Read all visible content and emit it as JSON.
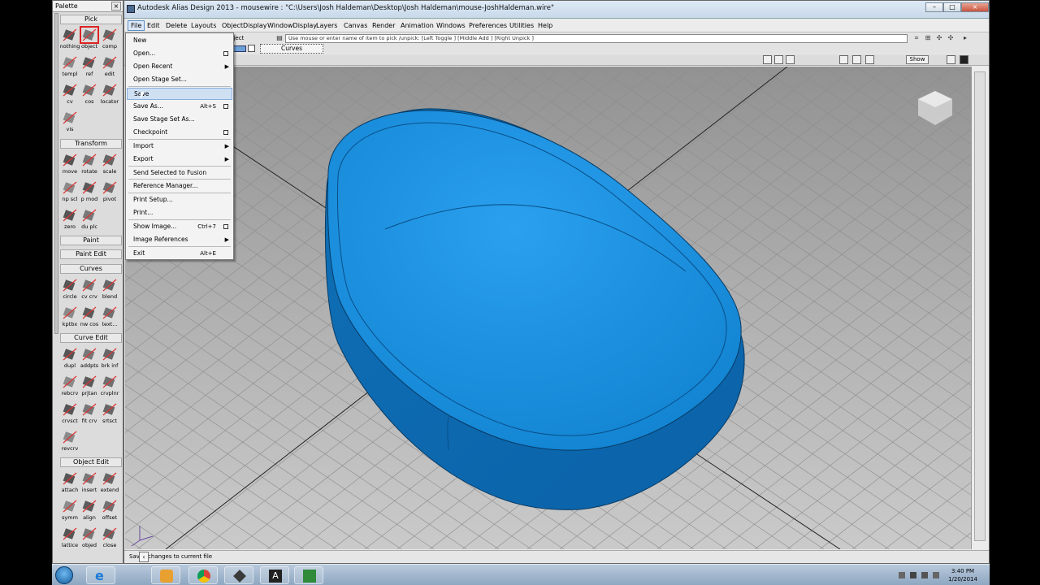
{
  "palette": {
    "title": "Palette",
    "sections": {
      "pick": "Pick",
      "transform": "Transform",
      "paint": "Paint",
      "paint_edit": "Paint Edit",
      "curves": "Curves",
      "curve_edit": "Curve Edit",
      "object_edit": "Object Edit"
    },
    "pick_tools": [
      "nothing",
      "object",
      "comp",
      "templ",
      "ref",
      "edit",
      "cv",
      "cos",
      "locator",
      "vis"
    ],
    "transform_tools": [
      "move",
      "rotate",
      "scale",
      "np scl",
      "p mod",
      "pivot",
      "zero",
      "du plc"
    ],
    "curve_tools": [
      "circle",
      "cv crv",
      "blend",
      "kptbx",
      "nw cos",
      "text..."
    ],
    "curve_edit_tools": [
      "dupl",
      "addpts",
      "brk inf",
      "rebcrv",
      "prjtan",
      "crvplnr",
      "crvsct",
      "fit crv",
      "srtsct",
      "revcrv"
    ],
    "object_edit_tools": [
      "attach",
      "insert",
      "extend",
      "symm",
      "align",
      "offset",
      "lattice",
      "objed",
      "close"
    ]
  },
  "window": {
    "title": "Autodesk Alias Design 2013 - mousewire : \"C:\\Users\\Josh Haldeman\\Desktop\\Josh Haldeman\\mouse-JoshHaldeman.wire\"",
    "menus": [
      "File",
      "Edit",
      "Delete",
      "Layouts",
      "ObjectDisplay",
      "WindowDisplay",
      "Layers",
      "Canvas",
      "Render",
      "Animation",
      "Windows",
      "Preferences",
      "Utilities",
      "Help"
    ],
    "prompt_label": "bject",
    "prompt_text": "Use mouse or enter name of item to pick /unpick: [Left Toggle ] [Middle Add ] [Right Unpick ]",
    "shelf_tab": "Curves",
    "show_button": "Show",
    "status_text": "Saves changes to current file"
  },
  "file_menu": [
    {
      "label": "New",
      "shortcut": "",
      "arrow": false,
      "box": false
    },
    {
      "label": "Open...",
      "shortcut": "",
      "arrow": false,
      "box": true
    },
    {
      "label": "Open Recent",
      "shortcut": "",
      "arrow": true,
      "box": false
    },
    {
      "label": "Open Stage Set...",
      "shortcut": "",
      "arrow": false,
      "box": false
    },
    {
      "label": "Save",
      "shortcut": "",
      "arrow": false,
      "box": false
    },
    {
      "label": "Save As...",
      "shortcut": "Alt+S",
      "arrow": false,
      "box": true
    },
    {
      "label": "Save Stage Set As...",
      "shortcut": "",
      "arrow": false,
      "box": false
    },
    {
      "label": "Checkpoint",
      "shortcut": "",
      "arrow": false,
      "box": true
    },
    {
      "label": "Import",
      "shortcut": "",
      "arrow": true,
      "box": false
    },
    {
      "label": "Export",
      "shortcut": "",
      "arrow": true,
      "box": false
    },
    {
      "label": "Send Selected to Fusion",
      "shortcut": "",
      "arrow": false,
      "box": false
    },
    {
      "label": "Reference Manager...",
      "shortcut": "",
      "arrow": false,
      "box": false
    },
    {
      "label": "Print Setup...",
      "shortcut": "",
      "arrow": false,
      "box": false
    },
    {
      "label": "Print...",
      "shortcut": "",
      "arrow": false,
      "box": false
    },
    {
      "label": "Show Image...",
      "shortcut": "Ctrl+7",
      "arrow": false,
      "box": true
    },
    {
      "label": "Image References",
      "shortcut": "",
      "arrow": true,
      "box": false
    },
    {
      "label": "Exit",
      "shortcut": "Alt+E",
      "arrow": false,
      "box": false
    }
  ],
  "taskbar": {
    "time": "3:40 PM",
    "date": "1/20/2014"
  },
  "colors": {
    "model_blue": "#1a8fe0",
    "menu_highlight": "#cfe0f3",
    "selection_red": "#d22222"
  }
}
